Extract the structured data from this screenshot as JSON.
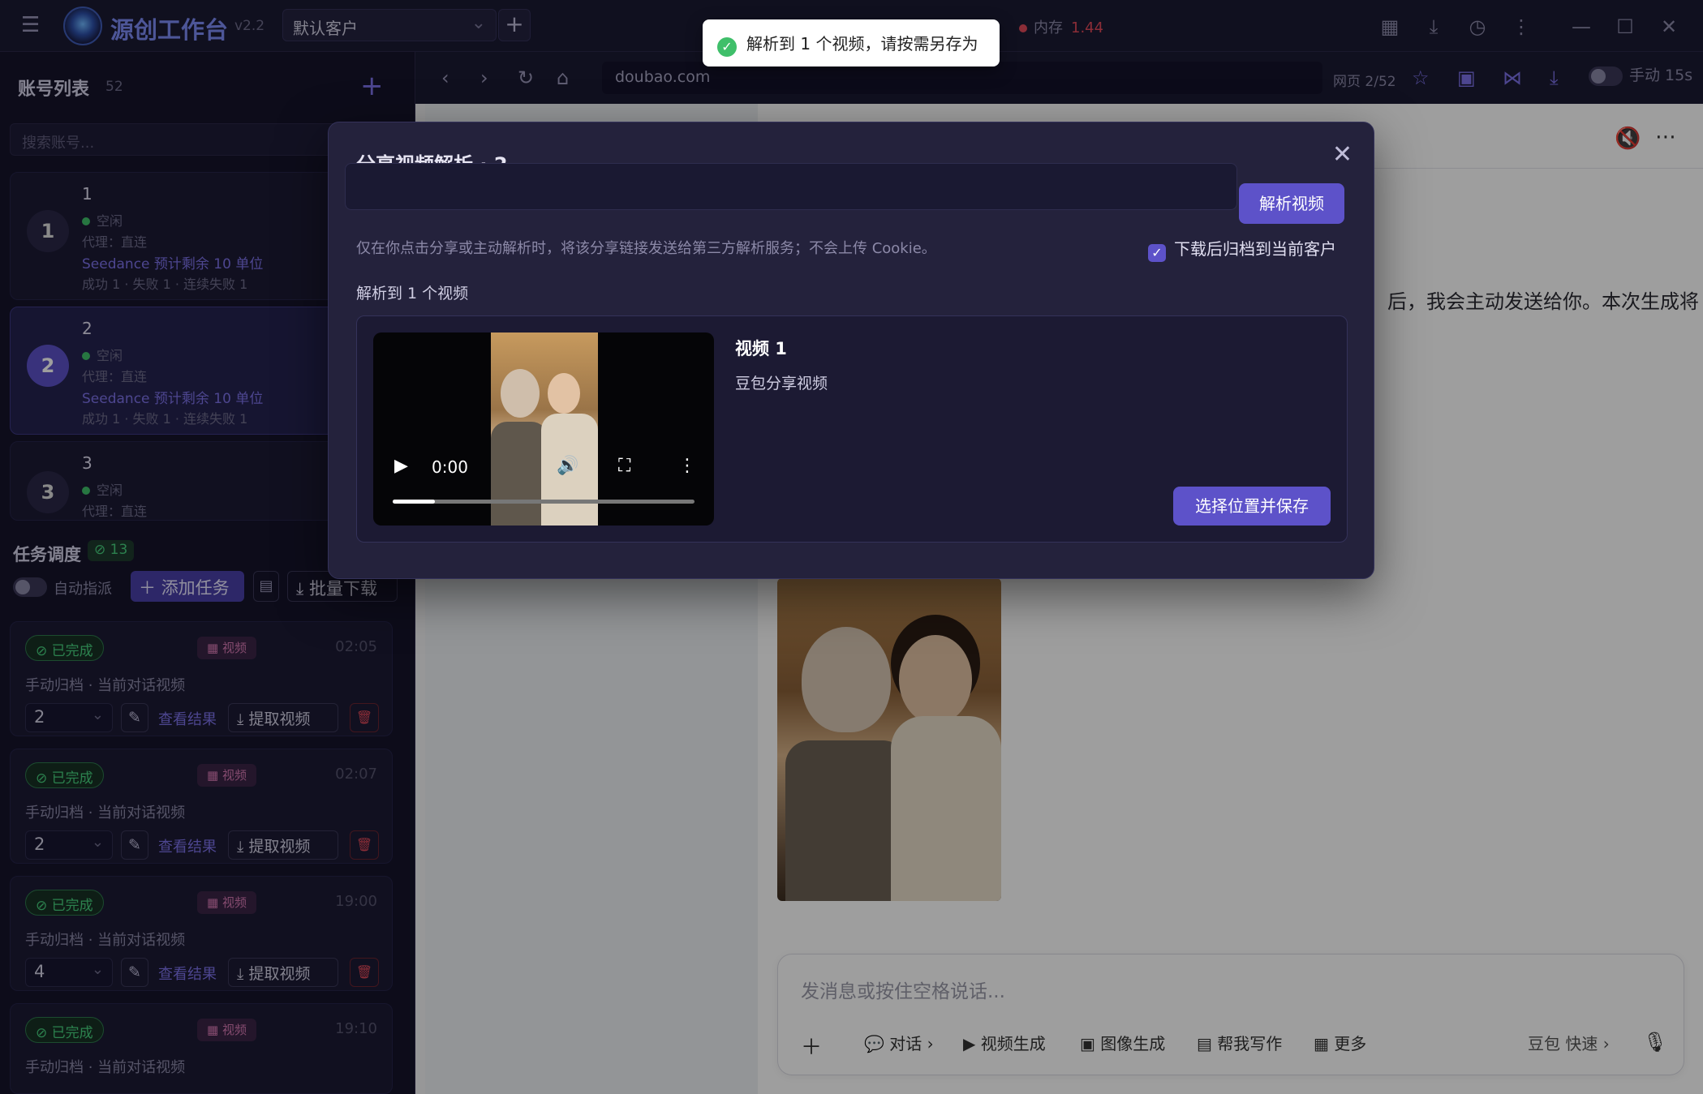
{
  "app": {
    "name": "源创工作台",
    "version": "v2.2",
    "client": "默认客户",
    "memory_label": "内存",
    "memory_value": "1.44"
  },
  "toast": {
    "text": "解析到 1 个视频，请按需另存为"
  },
  "accounts": {
    "title": "账号列表",
    "count": "52",
    "search_placeholder": "搜索账号...",
    "items": [
      {
        "badge": "1",
        "name": "1",
        "status": "空闲",
        "proxy": "代理：直连",
        "quota": "Seedance 预计剩余 10 单位",
        "stats": "成功 1 · 失败 1 · 连续失败 1"
      },
      {
        "badge": "2",
        "name": "2",
        "status": "空闲",
        "proxy": "代理：直连",
        "quota": "Seedance 预计剩余 10 单位",
        "stats": "成功 1 · 失败 1 · 连续失败 1"
      },
      {
        "badge": "3",
        "name": "3",
        "status": "空闲",
        "proxy": "代理：直连"
      }
    ]
  },
  "tasks": {
    "title": "任务调度",
    "count": "13",
    "auto_label": "自动指派",
    "add_label": "添加任务",
    "batch_label": "批量下载",
    "items": [
      {
        "status": "已完成",
        "tag": "视频",
        "time": "02:05",
        "desc": "手动归档 · 当前对话视频",
        "num": "2",
        "view": "查看结果",
        "extract": "提取视频"
      },
      {
        "status": "已完成",
        "tag": "视频",
        "time": "02:07",
        "desc": "手动归档 · 当前对话视频",
        "num": "2",
        "view": "查看结果",
        "extract": "提取视频"
      },
      {
        "status": "已完成",
        "tag": "视频",
        "time": "19:00",
        "desc": "手动归档 · 当前对话视频",
        "num": "4",
        "view": "查看结果",
        "extract": "提取视频"
      },
      {
        "status": "已完成",
        "tag": "视频",
        "time": "19:10",
        "desc": "手动归档 · 当前对话视频"
      }
    ]
  },
  "browser": {
    "url": "doubao.com",
    "page": "网页 2/52",
    "manual": "手动 15s"
  },
  "chat": {
    "text_fragment": "后，我会主动发送给你。本次生成将",
    "placeholder": "发消息或按住空格说话...",
    "tools": {
      "chat": "对话",
      "video": "视频生成",
      "image": "图像生成",
      "write": "帮我写作",
      "more": "更多",
      "model": "豆包 快速"
    }
  },
  "dialog": {
    "title": "分享视频解析 · 2",
    "parse_button": "解析视频",
    "note": "仅在你点击分享或主动解析时，将该分享链接发送给第三方解析服务；不会上传 Cookie。",
    "archive_label": "下载后归档到当前客户",
    "found": "解析到 1 个视频",
    "video": {
      "name": "视频 1",
      "desc": "豆包分享视频",
      "time": "0:00",
      "progress": 0.14,
      "save": "选择位置并保存"
    }
  }
}
